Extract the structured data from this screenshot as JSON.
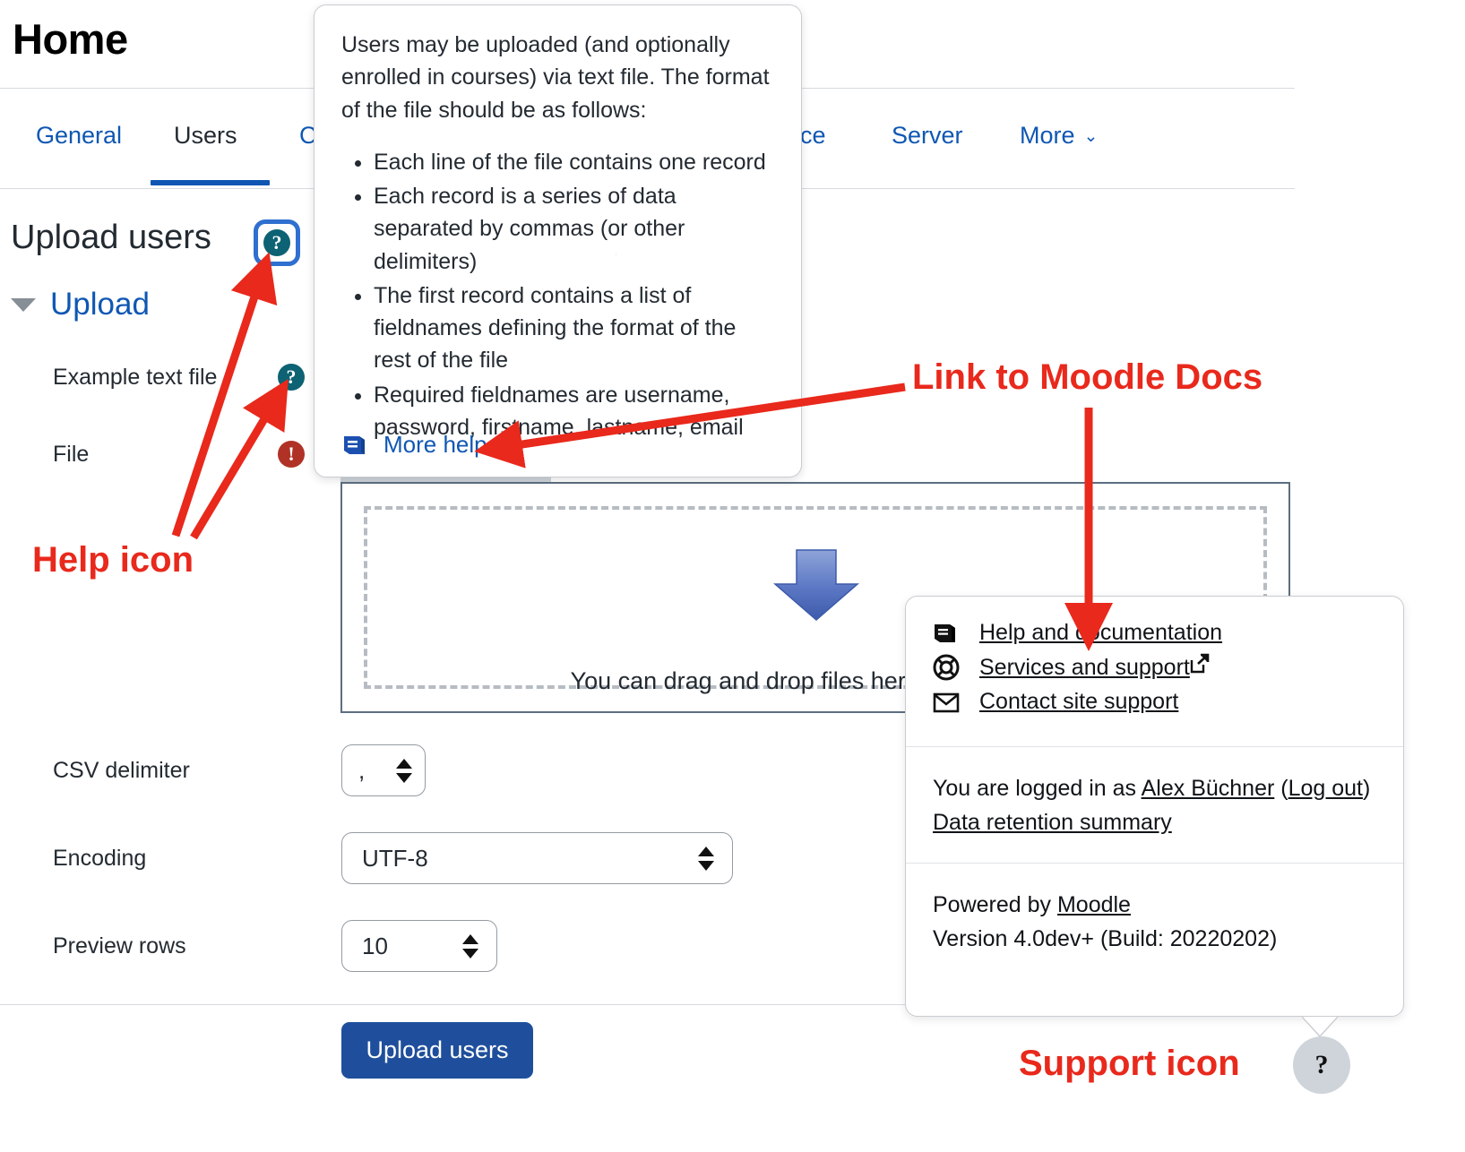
{
  "header": {
    "title": "Home"
  },
  "nav": {
    "tabs": [
      {
        "label": "General",
        "active": false
      },
      {
        "label": "Users",
        "active": true
      },
      {
        "label": "C",
        "active": false
      },
      {
        "label": "nce",
        "active": false
      },
      {
        "label": "Server",
        "active": false
      },
      {
        "label": "More",
        "active": false,
        "has_chevron": true
      }
    ],
    "chevron_glyph": "⌄"
  },
  "page": {
    "heading": "Upload users",
    "section_label": "Upload",
    "help_icon_glyph": "?"
  },
  "form": {
    "rows": [
      {
        "label": "Example text file",
        "icon": "help-icon"
      },
      {
        "label": "File",
        "icon": "error-icon"
      }
    ],
    "dropzone_text": "You can drag and drop files here to add them.",
    "csv_delimiter": {
      "label": "CSV delimiter",
      "value": ","
    },
    "encoding": {
      "label": "Encoding",
      "value": "UTF-8"
    },
    "preview_rows": {
      "label": "Preview rows",
      "value": "10"
    },
    "submit_label": "Upload users"
  },
  "help_popover": {
    "intro": "Users may be uploaded (and optionally enrolled in courses) via text file. The format of the file should be as follows:",
    "bullets": [
      "Each line of the file contains one record",
      "Each record is a series of data separated by commas (or other delimiters)",
      "The first record contains a list of fieldnames defining the format of the rest of the file",
      "Required fieldnames are username, password, firstname, lastname, email"
    ],
    "more_help_label": "More help"
  },
  "support_popover": {
    "links": [
      {
        "label": "Help and documentation",
        "icon": "book-icon",
        "external": false
      },
      {
        "label": "Services and support",
        "icon": "lifebuoy-icon",
        "external": true
      },
      {
        "label": "Contact site support",
        "icon": "envelope-icon",
        "external": false
      }
    ],
    "logged_in_prefix": "You are logged in as ",
    "user_name": "Alex Büchner",
    "logout_label": "Log out",
    "data_retention_label": "Data retention summary",
    "powered_by_prefix": "Powered by ",
    "powered_by_name": "Moodle",
    "version": "Version 4.0dev+ (Build: 20220202)",
    "support_icon_glyph": "?"
  },
  "annotations": [
    {
      "id": "help",
      "text": "Help icon"
    },
    {
      "id": "docs",
      "text": "Link to Moodle Docs"
    },
    {
      "id": "support",
      "text": "Support icon"
    }
  ],
  "colors": {
    "link_blue": "#0f57b3",
    "annotation_red": "#e8291c",
    "help_teal": "#0d6273",
    "error_red": "#b03226",
    "primary_button": "#1f4f9c"
  }
}
